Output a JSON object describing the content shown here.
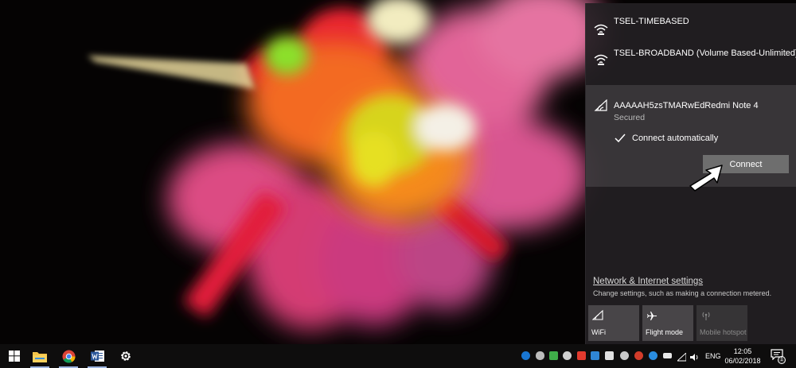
{
  "networks": [
    {
      "name": "TSEL-TIMEBASED"
    },
    {
      "name": "TSEL-BROADBAND (Volume Based-Unlimited)"
    }
  ],
  "selected_network": {
    "name": "AAAAAH5zsTMARwEdRedmi Note 4",
    "status": "Secured",
    "connect_automatically_label": "Connect automatically",
    "connect_automatically_checked": true,
    "connect_label": "Connect"
  },
  "settings": {
    "link": "Network & Internet settings",
    "sub": "Change settings, such as making a connection metered."
  },
  "quick_actions": [
    {
      "label": "WiFi",
      "icon": "wifi-icon",
      "state": "on"
    },
    {
      "label": "Flight mode",
      "icon": "airplane-icon",
      "state": "on"
    },
    {
      "label": "Mobile hotspot",
      "icon": "hotspot-icon",
      "state": "off"
    }
  ],
  "taskbar": {
    "apps": [
      "windows-start-icon",
      "file-explorer-icon",
      "chrome-icon",
      "word-icon",
      "settings-gear-icon"
    ],
    "language": "ENG",
    "time": "12:05",
    "date": "06/02/2018",
    "notification_count": "1"
  },
  "colors": {
    "flyout_bg": "#221f22",
    "connect_button": "#6e6e6e",
    "taskbar_bg": "#0e0d0d"
  }
}
